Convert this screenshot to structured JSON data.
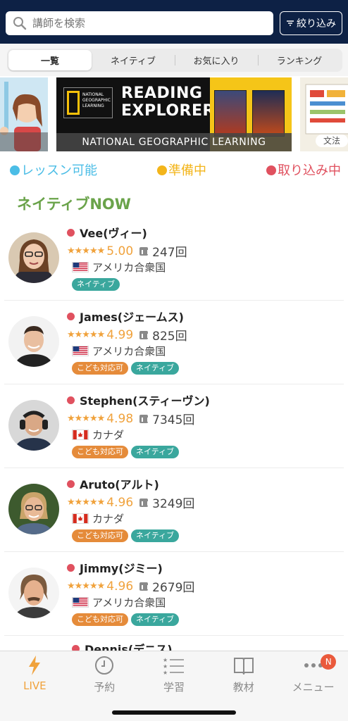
{
  "header": {
    "search_placeholder": "講師を検索",
    "filter_label": "絞り込み"
  },
  "tabs": [
    {
      "label": "一覧",
      "active": true
    },
    {
      "label": "ネイティブ",
      "active": false
    },
    {
      "label": "お気に入り",
      "active": false
    },
    {
      "label": "ランキング",
      "active": false
    }
  ],
  "banner": {
    "ng_logo_text": "NATIONAL GEOGRAPHIC LEARNING",
    "title_line1": "READING",
    "title_line2": "EXPLORER",
    "caption": "NATIONAL GEOGRAPHIC LEARNING",
    "right_tag": "文法"
  },
  "legend": {
    "available": "レッスン可能",
    "preparing": "準備中",
    "busy": "取り込み中",
    "colors": {
      "available": "#4bbde6",
      "preparing": "#f3b51b",
      "busy": "#e0515f"
    }
  },
  "section_title": "ネイティブNOW",
  "teachers": [
    {
      "name": "Vee(ヴィー)",
      "stars": "★★★★★",
      "rating": "5.00",
      "count": "247回",
      "flag": "us",
      "country": "アメリカ合衆国",
      "tags": [
        "ネイティブ"
      ]
    },
    {
      "name": "James(ジェームス)",
      "stars": "★★★★★",
      "rating": "4.99",
      "count": "825回",
      "flag": "us",
      "country": "アメリカ合衆国",
      "tags": [
        "こども対応可",
        "ネイティブ"
      ]
    },
    {
      "name": "Stephen(スティーヴン)",
      "stars": "★★★★★",
      "rating": "4.98",
      "count": "7345回",
      "flag": "ca",
      "country": "カナダ",
      "tags": [
        "こども対応可",
        "ネイティブ"
      ]
    },
    {
      "name": "Aruto(アルト)",
      "stars": "★★★★★",
      "rating": "4.96",
      "count": "3249回",
      "flag": "ca",
      "country": "カナダ",
      "tags": [
        "こども対応可",
        "ネイティブ"
      ]
    },
    {
      "name": "Jimmy(ジミー)",
      "stars": "★★★★★",
      "rating": "4.96",
      "count": "2679回",
      "flag": "us",
      "country": "アメリカ合衆国",
      "tags": [
        "こども対応可",
        "ネイティブ"
      ]
    }
  ],
  "partial_teacher_name": "Dennis(デニス)",
  "bottom_nav": [
    {
      "label": "LIVE",
      "icon": "lightning-icon",
      "active": true
    },
    {
      "label": "予約",
      "icon": "clock-icon",
      "active": false
    },
    {
      "label": "学習",
      "icon": "list-icon",
      "active": false
    },
    {
      "label": "教材",
      "icon": "book-icon",
      "active": false
    },
    {
      "label": "メニュー",
      "icon": "more-icon",
      "active": false,
      "badge": "N"
    }
  ]
}
